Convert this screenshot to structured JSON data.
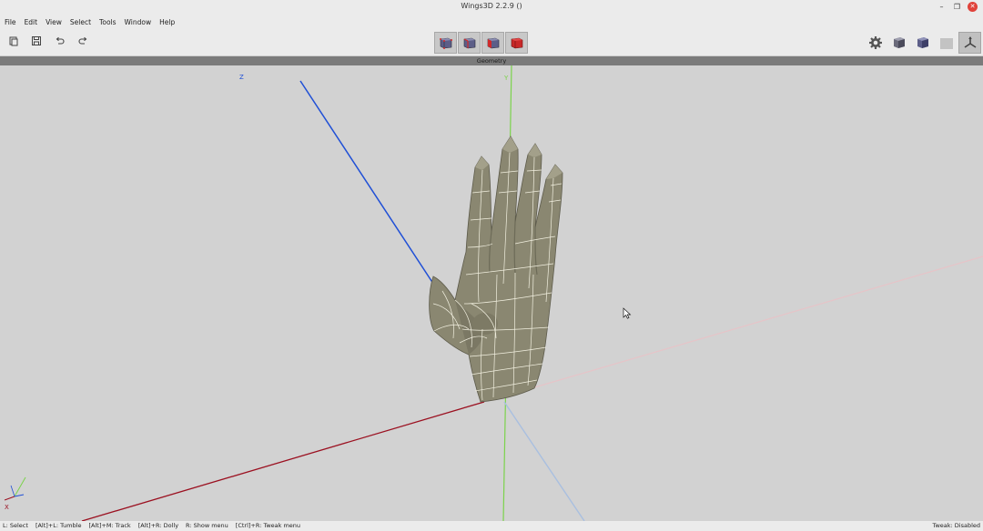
{
  "window": {
    "title": "Wings3D 2.2.9 ()"
  },
  "menu": {
    "items": [
      "File",
      "Edit",
      "View",
      "Select",
      "Tools",
      "Window",
      "Help"
    ]
  },
  "toolbar": {
    "left_icons": [
      "new-file-icon",
      "save-icon",
      "undo-icon",
      "redo-icon"
    ],
    "selection_modes": [
      "vertex-mode",
      "edge-mode",
      "face-mode",
      "body-mode"
    ],
    "right_icons": [
      "settings-icon",
      "smooth-preview-icon",
      "wireframe-cube-icon",
      "ground-plane-icon",
      "tweak-axes-icon"
    ]
  },
  "geometry": {
    "header": "Geometry"
  },
  "axes": {
    "z_label": "Z",
    "y_label": "Y",
    "x_label": "X"
  },
  "status": {
    "hints": [
      "L: Select",
      "[Alt]+L: Tumble",
      "[Alt]+M: Track",
      "[Alt]+R: Dolly",
      "R: Show menu",
      "[Ctrl]+R: Tweak menu"
    ],
    "tweak": "Tweak: Disabled"
  },
  "colors": {
    "x_axis": "#9b1020",
    "y_axis": "#7bd34b",
    "z_axis": "#1f4fd6",
    "model_fill": "#8a8771",
    "viewport_bg": "#d2d2d2",
    "face_selected": "#d12a2a"
  }
}
